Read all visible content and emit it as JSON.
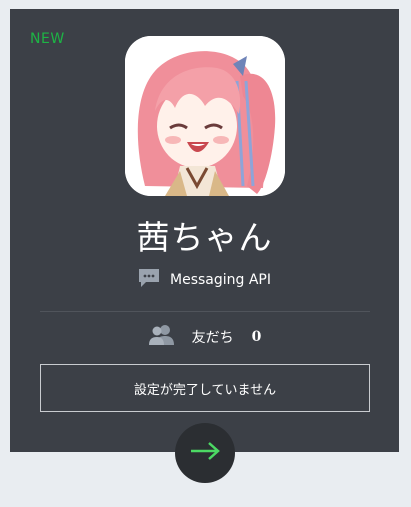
{
  "card": {
    "badge": "NEW",
    "bot_name": "茜ちゃん",
    "account_type": "Messaging API",
    "friends_label": "友だち",
    "friends_count": "0",
    "setup_status": "設定が完了していません"
  },
  "icons": {
    "chat": "chat-bubble-icon",
    "friends": "people-icon",
    "arrow": "arrow-right-icon"
  },
  "colors": {
    "card_bg": "#3c4047",
    "page_bg": "#e9edf1",
    "new_badge": "#1db445",
    "arrow": "#4cd964"
  }
}
